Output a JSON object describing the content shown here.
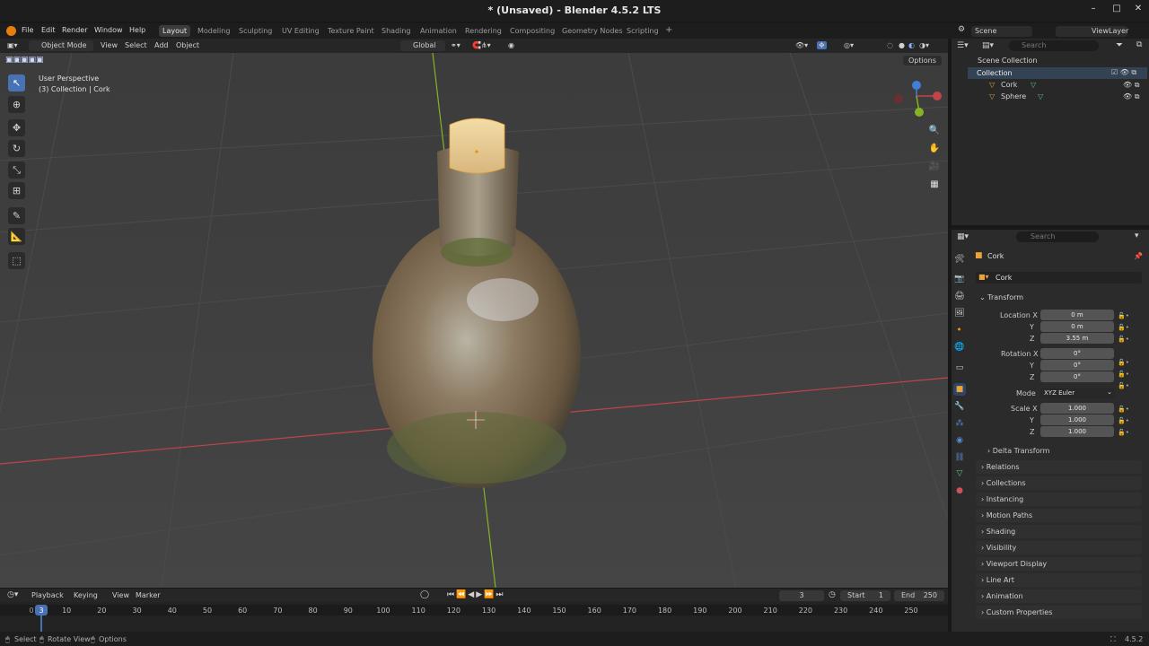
{
  "window": {
    "title": "* (Unsaved) - Blender 4.5.2 LTS",
    "minimize": "–",
    "maximize": "□",
    "close": "✕"
  },
  "menu": [
    "File",
    "Edit",
    "Render",
    "Window",
    "Help"
  ],
  "workspaces": [
    "Layout",
    "Modeling",
    "Sculpting",
    "UV Editing",
    "Texture Paint",
    "Shading",
    "Animation",
    "Rendering",
    "Compositing",
    "Geometry Nodes",
    "Scripting",
    "+"
  ],
  "active_workspace": "Layout",
  "scene": {
    "label": "Scene",
    "viewlayer": "ViewLayer"
  },
  "viewport_header": {
    "mode": "Object Mode",
    "items": [
      "View",
      "Select",
      "Add",
      "Object"
    ],
    "orientation": "Global"
  },
  "viewport": {
    "perspective": "User Perspective",
    "context": "(3) Collection | Cork",
    "options": "Options"
  },
  "outliner": {
    "search_placeholder": "Search",
    "root": "Scene Collection",
    "collection": "Collection",
    "objects": [
      "Cork",
      "Sphere"
    ]
  },
  "properties": {
    "search_placeholder": "Search",
    "object_name": "Cork",
    "datablock": "Cork",
    "transform": {
      "title": "Transform",
      "location_label": "Location X",
      "location": [
        "0 m",
        "0 m",
        "3.55 m"
      ],
      "rotation_label": "Rotation X",
      "rotation": [
        "0°",
        "0°",
        "0°"
      ],
      "mode_label": "Mode",
      "mode": "XYZ Euler",
      "scale_label": "Scale X",
      "scale": [
        "1.000",
        "1.000",
        "1.000"
      ],
      "y": "Y",
      "z": "Z"
    },
    "delta": "Delta Transform",
    "panels": [
      "Relations",
      "Collections",
      "Instancing",
      "Motion Paths",
      "Shading",
      "Visibility",
      "Viewport Display",
      "Line Art",
      "Animation",
      "Custom Properties"
    ]
  },
  "timeline": {
    "menus": [
      "Playback",
      "Keying",
      "View",
      "Marker"
    ],
    "current_frame": "3",
    "start_label": "Start",
    "start": "1",
    "end_label": "End",
    "end": "250",
    "ticks": [
      "0",
      "10",
      "20",
      "30",
      "40",
      "50",
      "60",
      "70",
      "80",
      "90",
      "100",
      "110",
      "120",
      "130",
      "140",
      "150",
      "160",
      "170",
      "180",
      "190",
      "200",
      "210",
      "220",
      "230",
      "240",
      "250"
    ]
  },
  "statusbar": {
    "select": "Select",
    "rotate": "Rotate View",
    "options": "Options",
    "version": "4.5.2"
  },
  "colors": {
    "accent": "#4772b3",
    "x_axis": "#c0444a",
    "y_axis": "#86b226",
    "z_axis": "#3f7fd6",
    "frame_marker": "#4772b3"
  }
}
